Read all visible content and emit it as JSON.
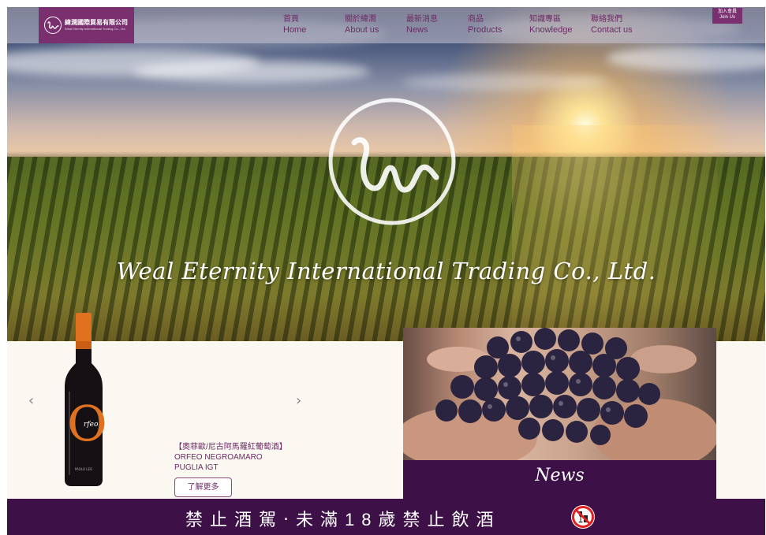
{
  "brand": {
    "name_zh": "緯潤國際貿易有限公司",
    "name_en": "Weal Eternity International Trading Co., Ltd."
  },
  "nav": [
    {
      "zh": "首頁",
      "en": "Home"
    },
    {
      "zh": "關於緯潤",
      "en": "About us"
    },
    {
      "zh": "最新消息",
      "en": "News"
    },
    {
      "zh": "商品",
      "en": "Products"
    },
    {
      "zh": "知識專區",
      "en": "Knowledge"
    },
    {
      "zh": "聯絡我們",
      "en": "Contact us"
    }
  ],
  "join": {
    "zh": "加入會員",
    "en": "Join Us"
  },
  "hero": {
    "tagline": "Weal Eternity International Trading Co., Ltd."
  },
  "product": {
    "title_zh": "【奧菲歐/尼古阿馬羅紅葡萄酒】",
    "name_line1": "ORFEO NEGROAMARO",
    "name_line2": "PUGLIA IGT",
    "button": "了解更多",
    "bottle_label_letter": "O",
    "bottle_label_word": "rfeo",
    "bottle_maker": "PAOLO LEO"
  },
  "carousel": {
    "prev_icon": "chevron-left-icon",
    "next_icon": "chevron-right-icon"
  },
  "news": {
    "label": "News"
  },
  "footer": {
    "warning": "禁止酒駕‧未滿18歲禁止飲酒",
    "icon": "no-drinking-icon"
  },
  "colors": {
    "brand_purple": "#7a2f6e",
    "dark_plum": "#3d1147",
    "cream": "#fbf8f2"
  }
}
